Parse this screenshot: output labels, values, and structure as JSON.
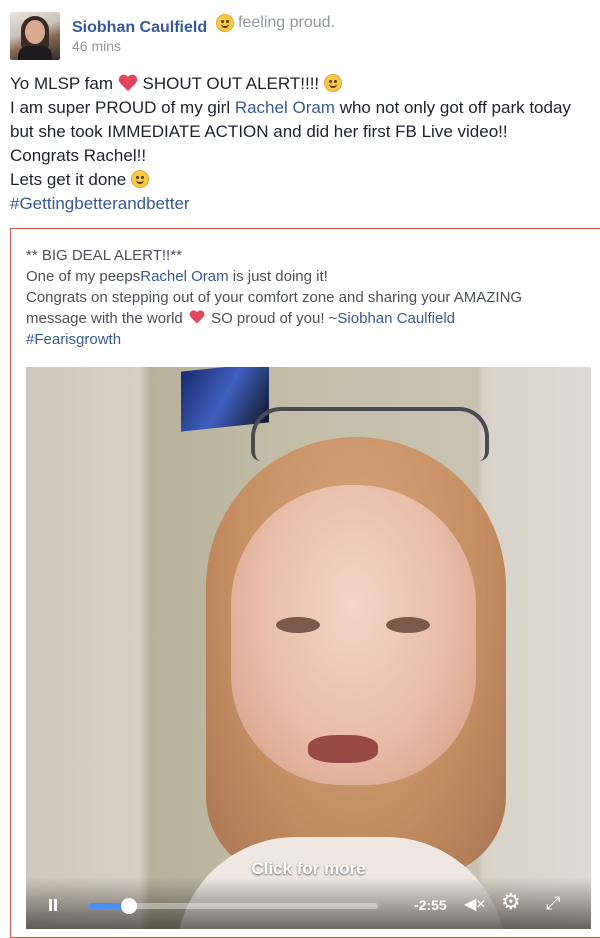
{
  "post": {
    "author": "Siobhan Caulfield",
    "feeling": "feeling proud.",
    "time": "46 mins",
    "lines": [
      "Yo MLSP fam",
      "SHOUT OUT ALERT!!!!",
      "I am super PROUD of my girl ",
      "Rachel Oram",
      " who not only got off park today",
      "but she took IMMEDIATE ACTION and did her first FB Live video!!",
      "Congrats Rachel!!",
      "Lets get it done",
      "#Gettingbetterandbetter"
    ]
  },
  "shared": {
    "line1": "** BIG DEAL ALERT!!**",
    "line2_prefix": "One of my peeps",
    "line2_link": "Rachel Oram",
    "line2_suffix": " is just doing it!",
    "line3": "Congrats on stepping out of your comfort zone and sharing your AMAZING",
    "line4_prefix": "message with the world",
    "line4_mid": " SO proud of you! ~",
    "line4_link": "Siobhan Caulfield",
    "hashtag": "#Fearisgrowth"
  },
  "video": {
    "overlay_text": "Click for more",
    "time_remaining": "-2:55",
    "progress": 0.14,
    "icons": [
      "pause-icon",
      "mute-icon",
      "settings-gear-icon",
      "fullscreen-icon"
    ]
  },
  "colors": {
    "link": "#365899",
    "heart": "#e0475c",
    "progress": "#4b8ff4",
    "share_border": "#d9534f"
  }
}
